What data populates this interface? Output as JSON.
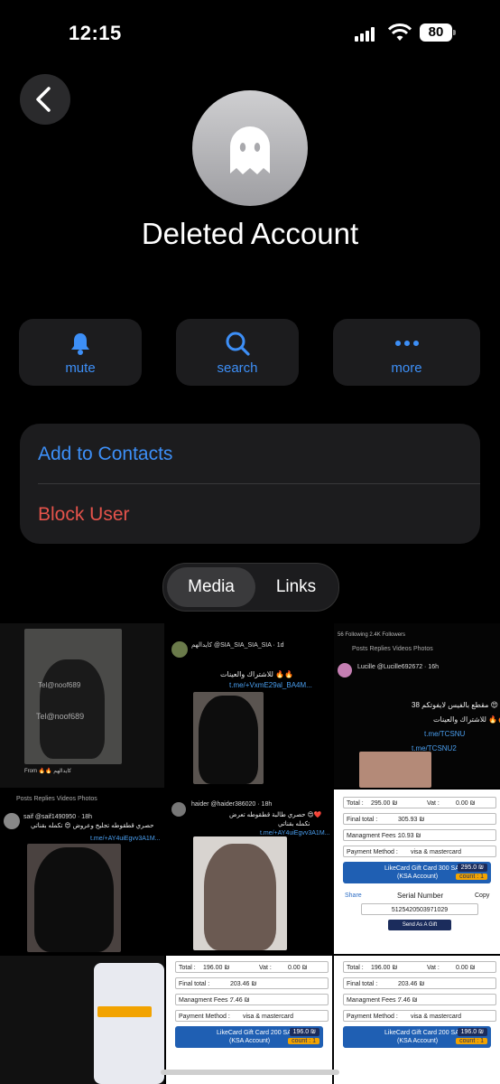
{
  "status_bar": {
    "time": "12:15",
    "battery": "80"
  },
  "profile": {
    "name": "Deleted Account"
  },
  "actions": [
    {
      "label": "mute",
      "icon": "bell-icon"
    },
    {
      "label": "search",
      "icon": "magnifier-icon"
    },
    {
      "label": "more",
      "icon": "ellipsis-icon"
    }
  ],
  "menu": {
    "add_contact": "Add to Contacts",
    "block_user": "Block User"
  },
  "tabs": {
    "media": "Media",
    "links": "Links"
  },
  "colors": {
    "accent": "#3d8ff7",
    "destructive": "#e5534b",
    "card_bg": "#1c1c1e"
  },
  "media_tiles": {
    "t1": {
      "watermark1": "Tel@noof689",
      "watermark2": "Tel@noof689",
      "from": "From 🔥🔥 كايدالهم"
    },
    "t2": {
      "handle": "كايدالهم @SIA_SIA_SIA_SIA · 1d",
      "line1": "للاشتراك والعينات 🔥🔥",
      "link": "t.me/+VxmE29al_BA4M..."
    },
    "t3": {
      "stats": "56 Following  2.4K Followers",
      "tabs": "Posts   Replies   Videos   Photos",
      "handle": "Lucille @Lucille692672 · 16h",
      "line1": "38 مقطع بالفيس لايفوتكم 😍",
      "line2": "للاشتراك والعينات 🔥🔥",
      "link1": "t.me/TCSNU",
      "link2": "t.me/TCSNU2"
    },
    "t4": {
      "tabs": "Posts   Replies   Videos   Photos",
      "handle": "saif @saif1490950 · 18h",
      "line1": "حصري قطقوطه تجليخ وعروض 😍 تكمله بقناتي",
      "link": "t.me/+AY4uiEgvv3A1M..."
    },
    "t5": {
      "handle": "haider @haider386020 · 18h",
      "line1": "حصري طالبة قطقوطه تعرض 😍❤️",
      "line2": "تكمله بقناتي",
      "link": "t.me/+AY4uiEgvv3A1M..."
    },
    "t6": {
      "total_label": "Total :",
      "total": "295.00 ₪",
      "vat_label": "Vat :",
      "vat": "0.00 ₪",
      "final_label": "Final total :",
      "final": "305.93 ₪",
      "fees_label": "Managment Fees :",
      "fees": "10.93 ₪",
      "payment_label": "Payment Method :",
      "payment": "visa & mastercard",
      "card": "LikeCard Gift Card 300 SAR",
      "card_sub": "(KSA Account)",
      "amount": "295.0 ₪",
      "count": "count : 1",
      "share": "Share",
      "serial_label": "Serial Number",
      "copy": "Copy",
      "serial": "5125420503971029",
      "gift": "Send As A Gift"
    },
    "t8": {
      "total_label": "Total :",
      "total": "196.00 ₪",
      "vat_label": "Vat :",
      "vat": "0.00 ₪",
      "final_label": "Final total :",
      "final": "203.46 ₪",
      "fees_label": "Managment Fees :",
      "fees": "7.46 ₪",
      "payment_label": "Payment Method :",
      "payment": "visa & mastercard",
      "card": "LikeCard Gift Card 200 SAR",
      "card_sub": "(KSA Account)",
      "amount": "196.0 ₪",
      "count": "count : 1"
    },
    "t9": {
      "total_label": "Total :",
      "total": "196.00 ₪",
      "vat_label": "Vat :",
      "vat": "0.00 ₪",
      "final_label": "Final total :",
      "final": "203.46 ₪",
      "fees_label": "Managment Fees :",
      "fees": "7.46 ₪",
      "payment_label": "Payment Method :",
      "payment": "visa & mastercard",
      "card": "LikeCard Gift Card 200 SAR",
      "card_sub": "(KSA Account)",
      "amount": "196.0 ₪",
      "count": "count : 1"
    }
  }
}
